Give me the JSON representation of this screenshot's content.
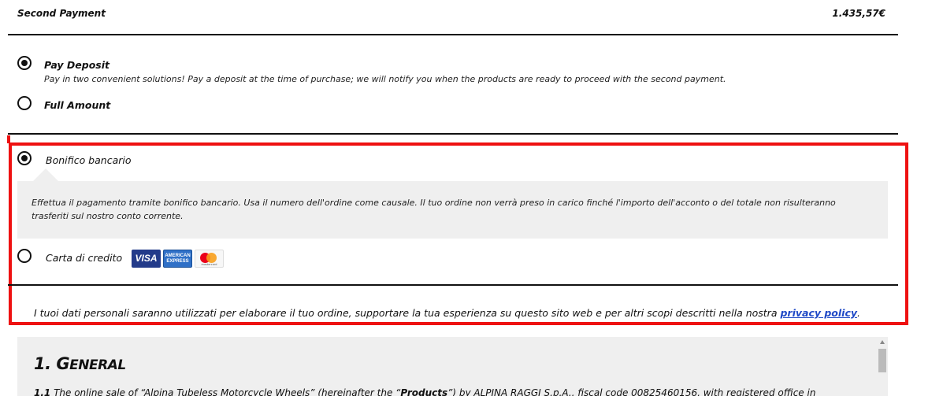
{
  "second_payment": {
    "label": "Second Payment",
    "amount": "1.435,57€"
  },
  "payment_plan": {
    "deposit": {
      "title": "Pay Deposit",
      "description": "Pay in two convenient solutions! Pay a deposit at the time of purchase; we will notify you when the products are ready to proceed with the second payment.",
      "selected": true
    },
    "full": {
      "title": "Full Amount",
      "selected": false
    }
  },
  "payment_methods": {
    "bank": {
      "label": "Bonifico bancario",
      "selected": true,
      "info": "Effettua il pagamento tramite bonifico bancario. Usa il numero dell'ordine come causale. Il tuo ordine non verrà preso in carico finché l'importo dell'acconto o del totale non risulteranno trasferiti sul nostro conto corrente."
    },
    "card": {
      "label": "Carta di credito",
      "selected": false,
      "cards": {
        "visa": "VISA",
        "amex_line1": "AMERICAN",
        "amex_line2": "EXPRESS",
        "mastercard": "mastercard"
      }
    }
  },
  "privacy": {
    "text": "I tuoi dati personali saranno utilizzati per elaborare il tuo ordine, supportare la tua esperienza su questo sito web e per altri scopi descritti nella nostra ",
    "link": "privacy policy",
    "end": "."
  },
  "terms": {
    "heading_num": "1. G",
    "heading_rest": "ENERAL",
    "para_num": "1.1",
    "para_text_a": " The online sale of “Alpina Tubeless Motorcycle Wheels” (hereinafter the “",
    "para_bold": "Products",
    "para_text_b": "”) by ALPINA RAGGI S.p.A., fiscal code 00825460156, with registered office in"
  },
  "colors": {
    "highlight": "#ee1111",
    "link": "#1f49c6",
    "panel": "#efefef"
  }
}
